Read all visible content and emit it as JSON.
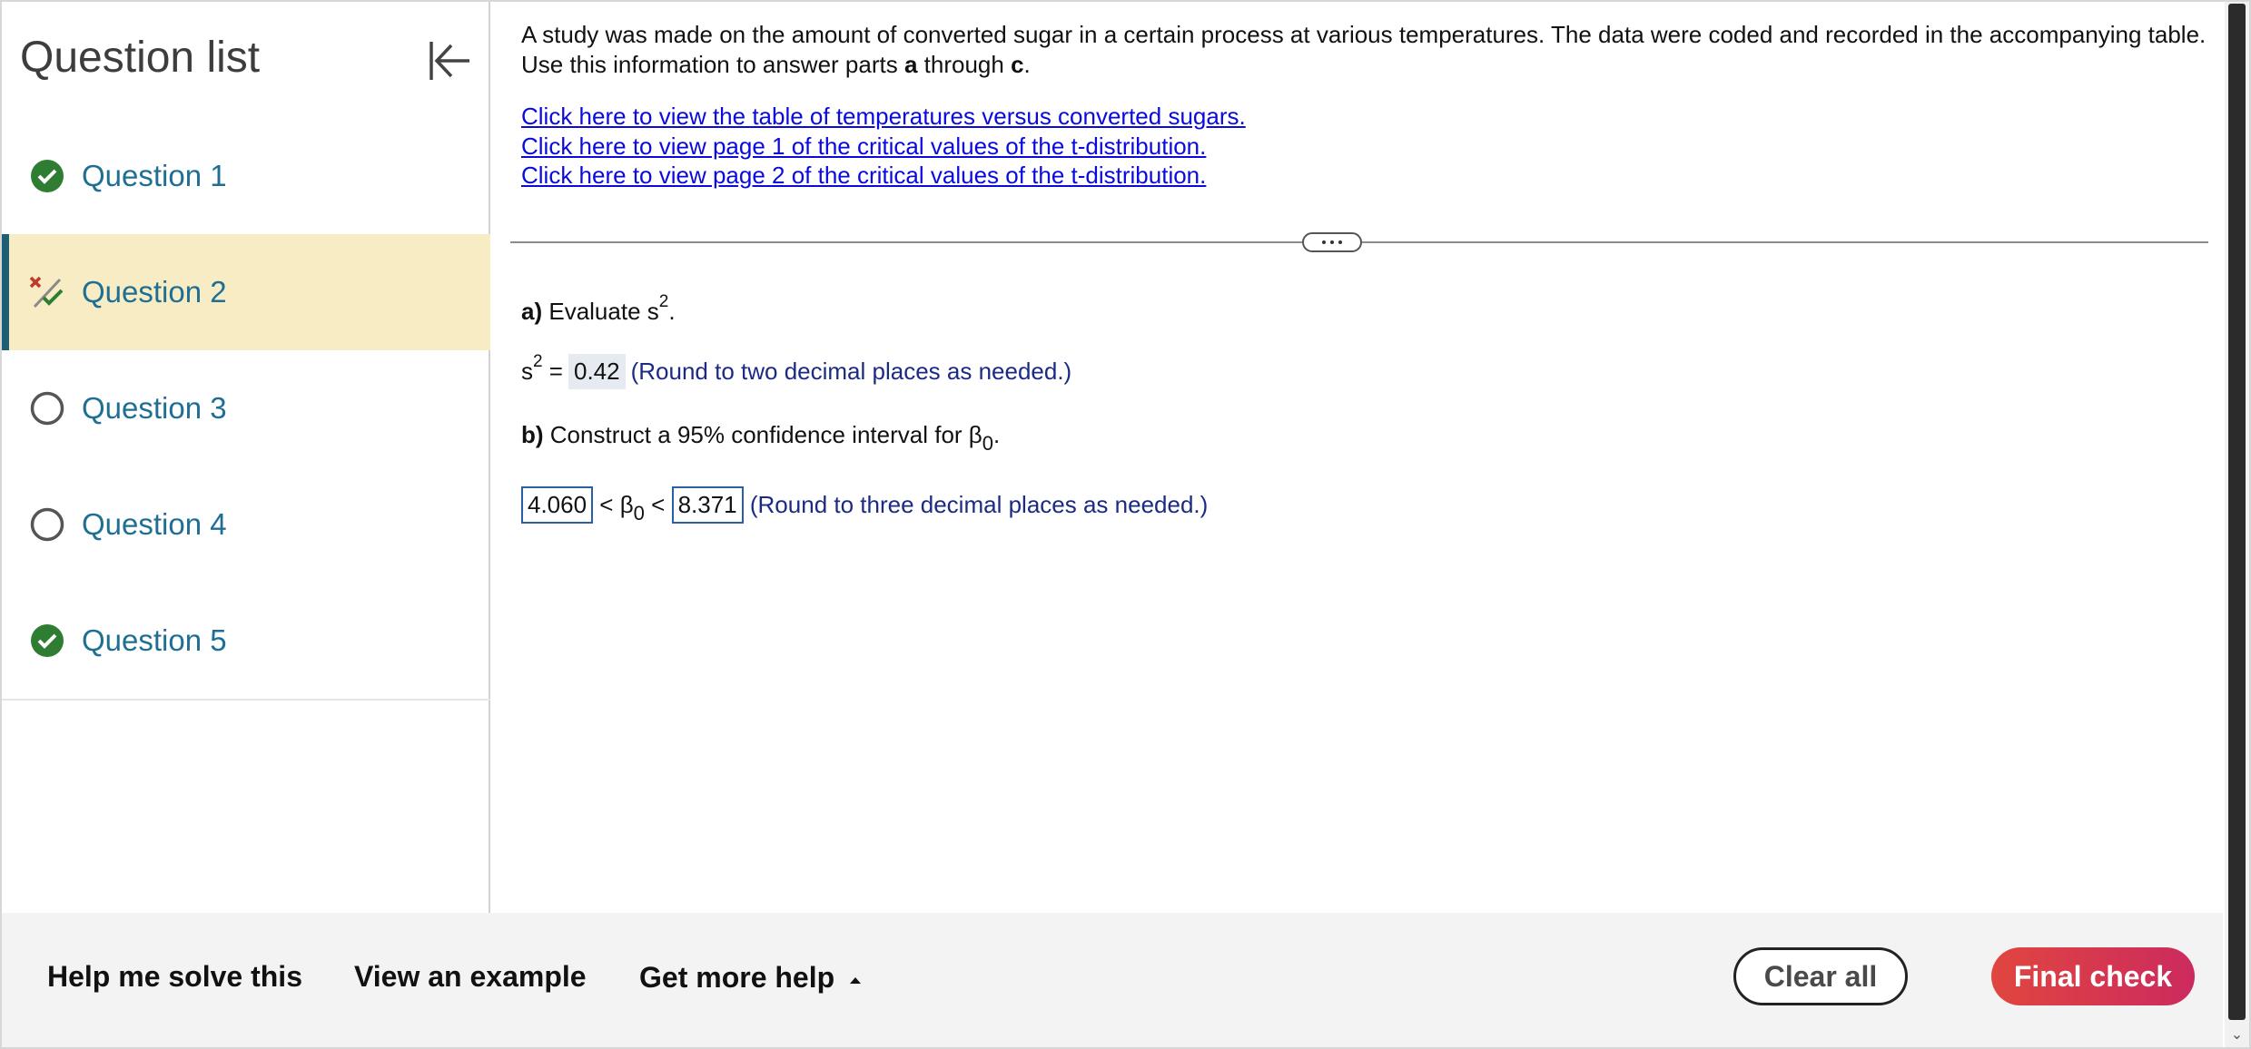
{
  "sidebar": {
    "title": "Question list",
    "collapse_icon": "collapse-left-icon",
    "items": [
      {
        "label": "Question 1",
        "status": "correct",
        "icon": "check-circle-icon"
      },
      {
        "label": "Question 2",
        "status": "partial",
        "icon": "partial-check-icon",
        "active": true
      },
      {
        "label": "Question 3",
        "status": "unanswered",
        "icon": "empty-circle-icon"
      },
      {
        "label": "Question 4",
        "status": "unanswered",
        "icon": "empty-circle-icon"
      },
      {
        "label": "Question 5",
        "status": "correct",
        "icon": "check-circle-icon"
      }
    ]
  },
  "question": {
    "intro_part1": "A study was made on the amount of converted sugar in a certain process at various temperatures. The data were coded and recorded in the accompanying table. Use this information to answer parts ",
    "intro_bold_a": "a",
    "intro_through": " through ",
    "intro_bold_c": "c",
    "intro_end": ".",
    "links": [
      "Click here to view the table of temperatures versus converted sugars.",
      "Click here to view page 1 of the critical values of the t-distribution.",
      "Click here to view page 2 of the critical values of the t-distribution."
    ]
  },
  "part_a": {
    "label": "a)",
    "prompt": " Evaluate s",
    "exponent": "2",
    "prompt_end": ".",
    "answer_prefix": "s",
    "answer_exponent": "2",
    "answer_equals": " =",
    "answer_value": "0.42",
    "hint": "(Round to two decimal places as needed.)"
  },
  "part_b": {
    "label": "b)",
    "prompt": " Construct a 95% confidence interval for β",
    "prompt_sub": "0",
    "prompt_end": ".",
    "lower_value": "4.060",
    "middle": " < β",
    "middle_sub": "0",
    "middle_end": " < ",
    "upper_value": "8.371",
    "hint": "(Round to three decimal places as needed.)"
  },
  "footer": {
    "help_solve": "Help me solve this",
    "view_example": "View an example",
    "more_help": "Get more help",
    "more_help_icon": "caret-up-icon",
    "clear_all": "Clear all",
    "final_check": "Final check"
  },
  "colors": {
    "accent_active_bg": "#f7ecc4",
    "question_label": "#1f6e93",
    "link": "#0a0adf",
    "correct": "#2e7d32",
    "partial_x": "#c0392b",
    "final_check_start": "#e0463f",
    "final_check_end": "#cc2a5e"
  }
}
